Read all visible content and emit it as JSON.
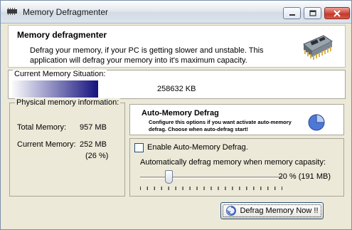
{
  "window": {
    "title": "Memory Defragmenter"
  },
  "colors": {
    "memory_bar_start": "#ffffff",
    "memory_bar_end": "#14127e",
    "close_button": "#c5382b"
  },
  "header": {
    "title": "Memory defragmenter",
    "description_line1": "Defrag your memory, if your PC is getting slower and unstable. This",
    "description_line2": "application will defrag your memory into it's maximum capacity.",
    "icon": "memory-chip-icon"
  },
  "situation": {
    "label": "Current Memory Situation:",
    "value": "258632 KB"
  },
  "physical": {
    "label": "Physical memory information:",
    "total_label": "Total Memory:",
    "total_value": "957 MB",
    "current_label": "Current Memory:",
    "current_value": "252 MB",
    "current_percent": "(26 %)"
  },
  "auto": {
    "title": "Auto-Memory Defrag",
    "description": "Configure this options if you want activate auto-memory defrag. Choose when auto-defrag start!",
    "icon": "pie-chart-icon",
    "enable_label": "Enable Auto-Memory Defrag.",
    "enable_checked": false,
    "slider_label": "Automatically defrag memory when memory capasity:",
    "slider_value": "20 % (191 MB)",
    "slider_fraction": 0.2
  },
  "button": {
    "label": "Defrag Memory Now !!",
    "icon": "defrag-icon"
  }
}
